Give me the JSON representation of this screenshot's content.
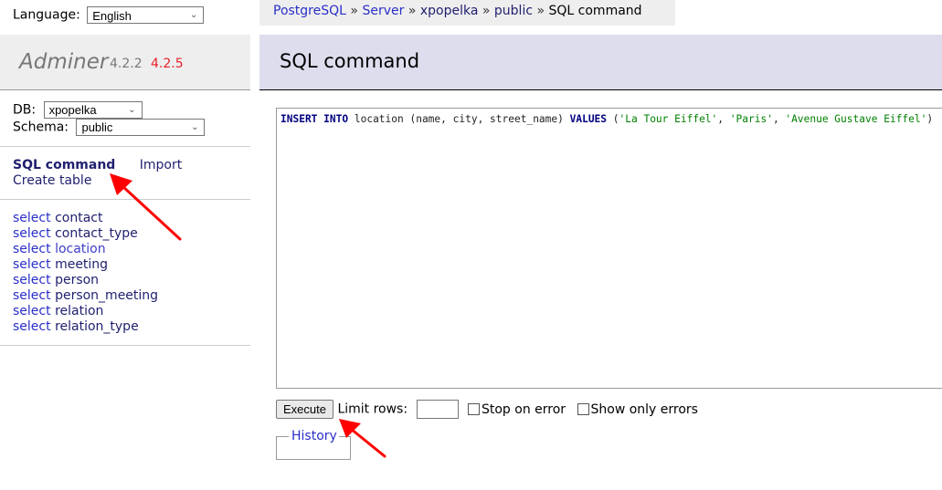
{
  "sidebar": {
    "language_label": "Language:",
    "language_value": "English",
    "logo": {
      "name": "Adminer",
      "version": "4.2.2",
      "new_version": "4.2.5"
    },
    "db_label": "DB:",
    "db_value": "xpopelka",
    "schema_label": "Schema:",
    "schema_value": "public",
    "menu": {
      "sql_command": "SQL command",
      "import": "Import",
      "create_table": "Create table"
    },
    "select_prefix": "select",
    "tables": [
      {
        "name": "contact"
      },
      {
        "name": "contact_type"
      },
      {
        "name": "location"
      },
      {
        "name": "meeting"
      },
      {
        "name": "person"
      },
      {
        "name": "person_meeting"
      },
      {
        "name": "relation"
      },
      {
        "name": "relation_type"
      }
    ]
  },
  "breadcrumb": {
    "items": [
      "PostgreSQL",
      "Server",
      "xpopelka",
      "public"
    ],
    "separator": "»",
    "current": "SQL command"
  },
  "header": {
    "title": "SQL command"
  },
  "sql": {
    "tokens": [
      {
        "t": "INSERT",
        "c": "kw"
      },
      {
        "t": " ",
        "c": "plain"
      },
      {
        "t": "INTO",
        "c": "kw"
      },
      {
        "t": " location (name, city, street_name) ",
        "c": "plain"
      },
      {
        "t": "VALUES",
        "c": "kw"
      },
      {
        "t": " (",
        "c": "plain"
      },
      {
        "t": "'La Tour Eiffel'",
        "c": "str"
      },
      {
        "t": ", ",
        "c": "plain"
      },
      {
        "t": "'Paris'",
        "c": "str"
      },
      {
        "t": ", ",
        "c": "plain"
      },
      {
        "t": "'Avenue Gustave Eiffel'",
        "c": "str"
      },
      {
        "t": ")",
        "c": "plain"
      }
    ]
  },
  "controls": {
    "execute_label": "Execute",
    "limit_rows_label": "Limit rows:",
    "limit_rows_value": "",
    "stop_on_error_label": "Stop on error",
    "stop_on_error_checked": false,
    "show_only_errors_label": "Show only errors",
    "show_only_errors_checked": false,
    "history_label": "History"
  },
  "annotations": {
    "arrow_color": "#ff0000"
  }
}
